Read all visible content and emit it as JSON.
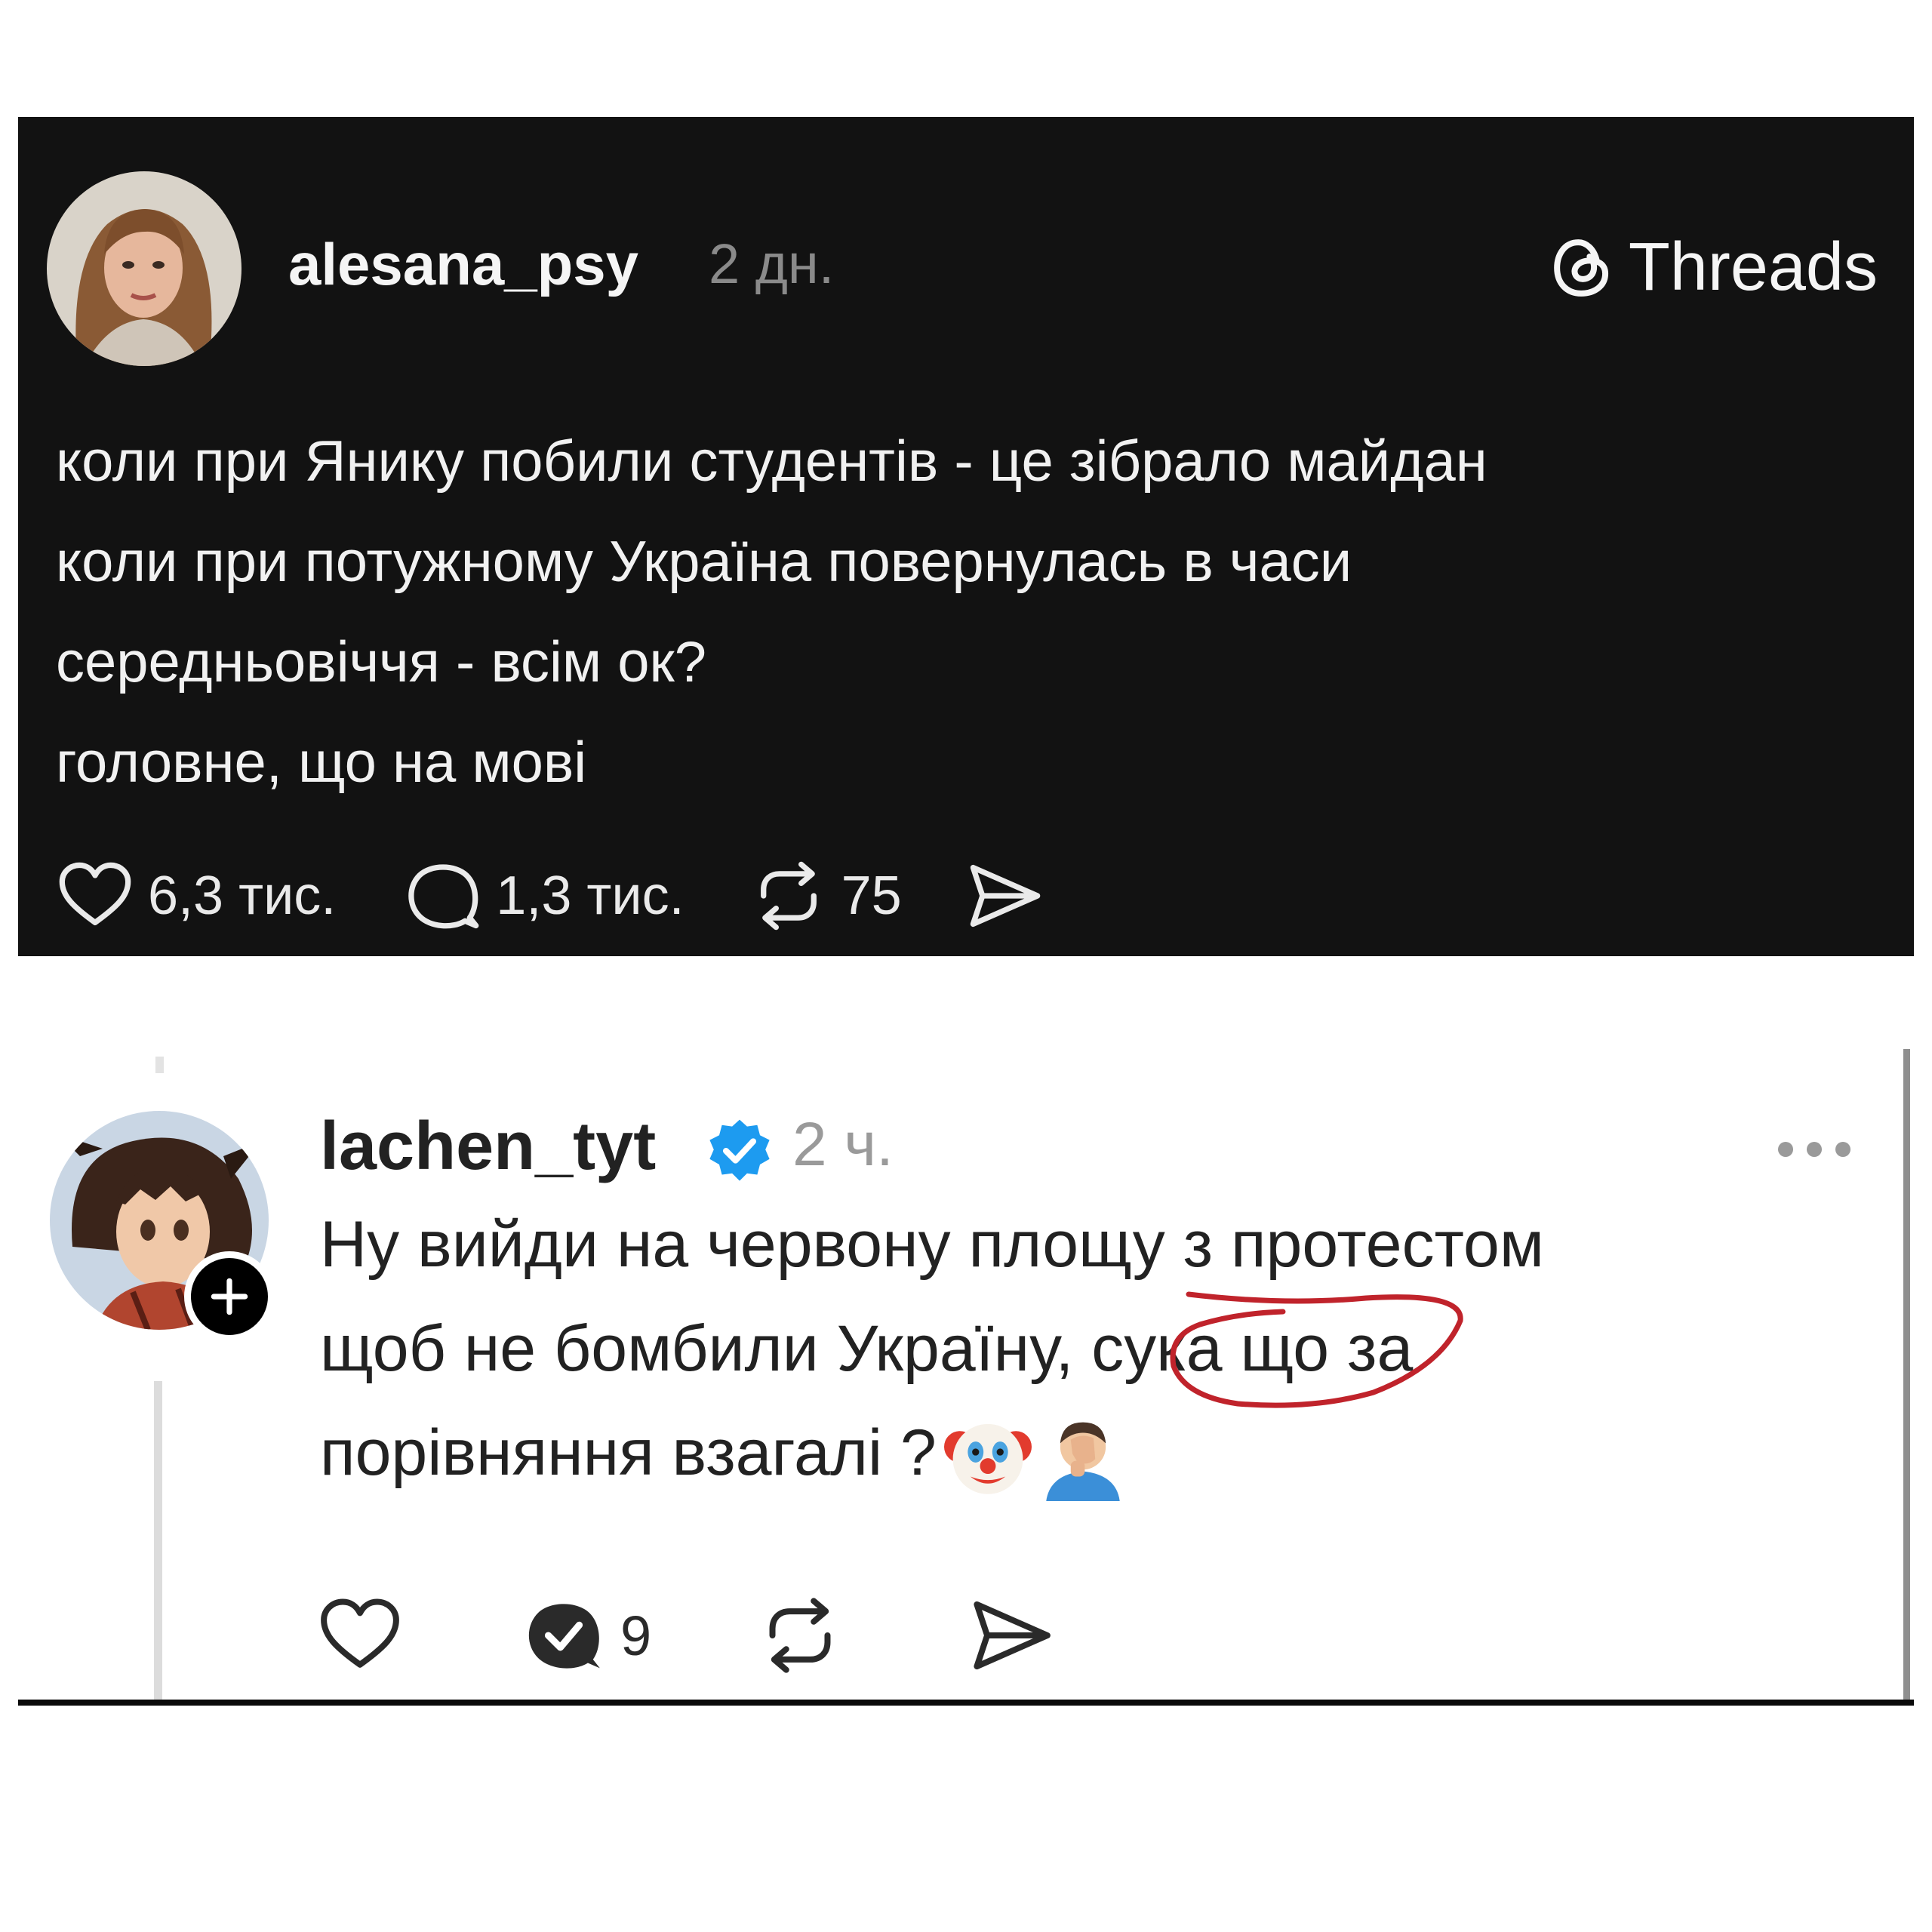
{
  "post": {
    "username": "alesana_psy",
    "time": "2 дн.",
    "brand": "Threads",
    "text_lines": [
      "коли при Янику побили студентів - це зібрало майдан",
      "коли при потужному Україна повернулась в часи",
      "середньовіччя - всім ок?",
      "головне, що на мові"
    ],
    "likes": "6,3 тис.",
    "replies": "1,3 тис.",
    "reposts": "75",
    "icons": [
      "heart-icon",
      "comment-icon",
      "repost-icon",
      "share-icon",
      "threads-logo-icon"
    ]
  },
  "reply": {
    "username": "lachen_tyt",
    "time": "2 ч.",
    "text_lines": [
      "Ну вийди на червону площу з протестом",
      "щоб не бомбили Україну, сука що за",
      "порівняння взагалі ?"
    ],
    "replies": "9",
    "icons": [
      "verified-icon",
      "more-icon",
      "follow-plus-icon",
      "clown-emoji",
      "facepalm-emoji",
      "heart-icon",
      "replied-icon",
      "repost-icon",
      "share-icon"
    ],
    "annotation_color": "#c0232b"
  }
}
